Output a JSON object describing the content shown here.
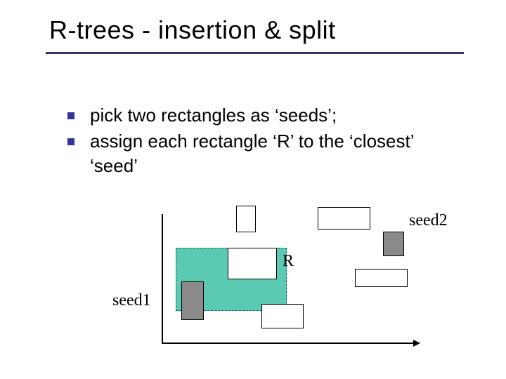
{
  "title": "R-trees - insertion & split",
  "bullets": [
    "pick two rectangles as ‘seeds’;",
    "assign each rectangle ‘R’ to the ‘closest’ ‘seed’"
  ],
  "labels": {
    "seed1": "seed1",
    "seed2": "seed2",
    "R": "R"
  }
}
